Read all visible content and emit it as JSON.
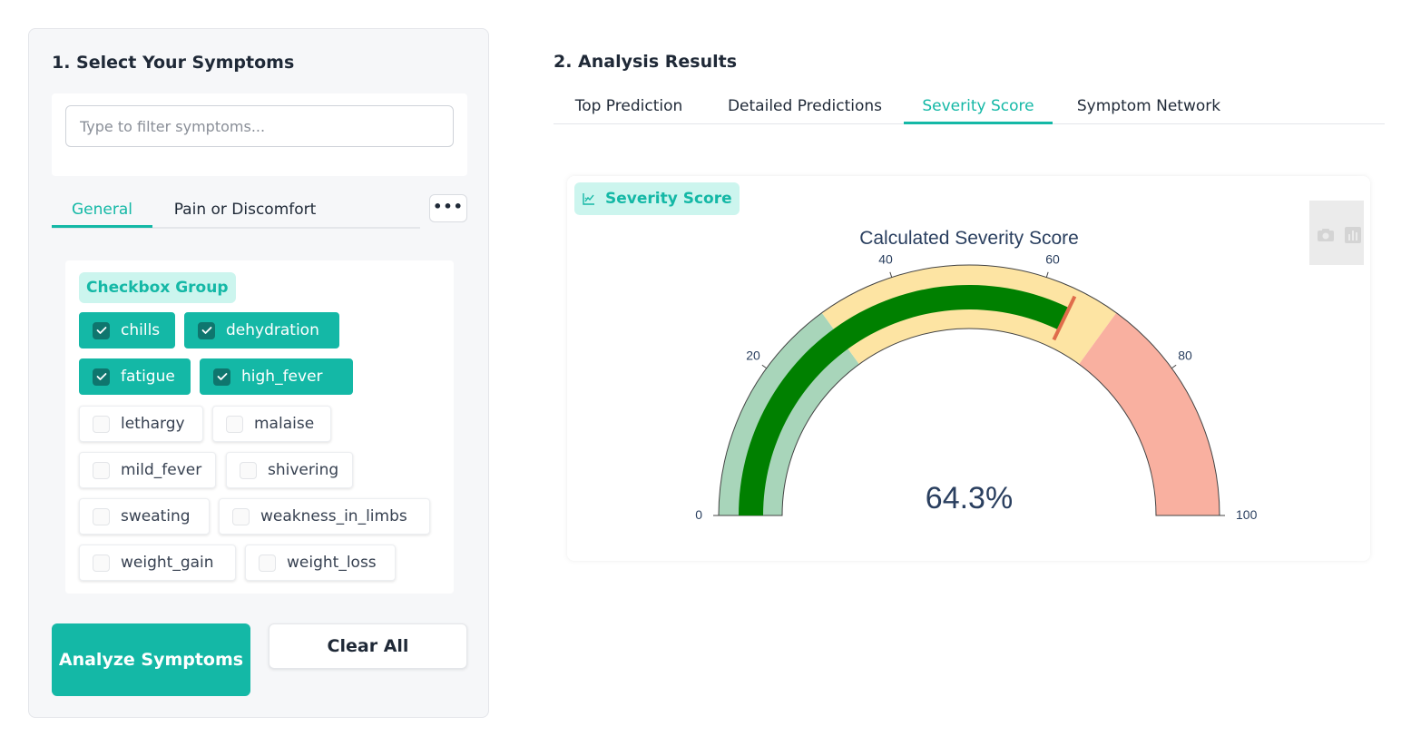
{
  "symptoms_panel": {
    "title": "1. Select Your Symptoms",
    "filter_placeholder": "Type to filter symptoms...",
    "filter_value": "",
    "tabs": [
      {
        "label": "General",
        "active": true
      },
      {
        "label": "Pain or Discomfort",
        "active": false
      }
    ],
    "more_label": "•••",
    "group_label": "Checkbox Group",
    "symptoms": [
      {
        "label": "chills",
        "checked": true
      },
      {
        "label": "dehydration",
        "checked": true
      },
      {
        "label": "fatigue",
        "checked": true
      },
      {
        "label": "high_fever",
        "checked": true
      },
      {
        "label": "lethargy",
        "checked": false
      },
      {
        "label": "malaise",
        "checked": false
      },
      {
        "label": "mild_fever",
        "checked": false
      },
      {
        "label": "shivering",
        "checked": false
      },
      {
        "label": "sweating",
        "checked": false
      },
      {
        "label": "weakness_in_limbs",
        "checked": false
      },
      {
        "label": "weight_gain",
        "checked": false
      },
      {
        "label": "weight_loss",
        "checked": false
      }
    ],
    "analyze_label": "Analyze Symptoms",
    "clear_label": "Clear All"
  },
  "results_panel": {
    "title": "2. Analysis Results",
    "tabs": [
      {
        "label": "Top Prediction",
        "active": false
      },
      {
        "label": "Detailed Predictions",
        "active": false
      },
      {
        "label": "Severity Score",
        "active": true
      },
      {
        "label": "Symptom Network",
        "active": false
      }
    ],
    "plot_label": "Severity Score",
    "plot_label_icon": "chart-icon",
    "modebar_icons": [
      "camera-icon",
      "bar-chart-icon"
    ]
  },
  "chart_data": {
    "type": "gauge",
    "title": "Calculated Severity Score",
    "value": 64.3,
    "value_text": "64.3%",
    "range": [
      0,
      100
    ],
    "tick_values": [
      0,
      20,
      40,
      60,
      80,
      100
    ],
    "tick_labels": [
      "0",
      "20",
      "40",
      "60",
      "80",
      "100"
    ],
    "bands": [
      {
        "from": 0,
        "to": 30,
        "color": "#a8d5ba"
      },
      {
        "from": 30,
        "to": 70,
        "color": "#fde4a3"
      },
      {
        "from": 70,
        "to": 100,
        "color": "#f9b0a0"
      }
    ],
    "bar_color": "#008000",
    "threshold": 64.3,
    "threshold_color": "#e06c4b"
  },
  "colors": {
    "accent": "#14b8a6",
    "accent_light": "#ccf5ee",
    "checked_box": "#0f766e"
  }
}
